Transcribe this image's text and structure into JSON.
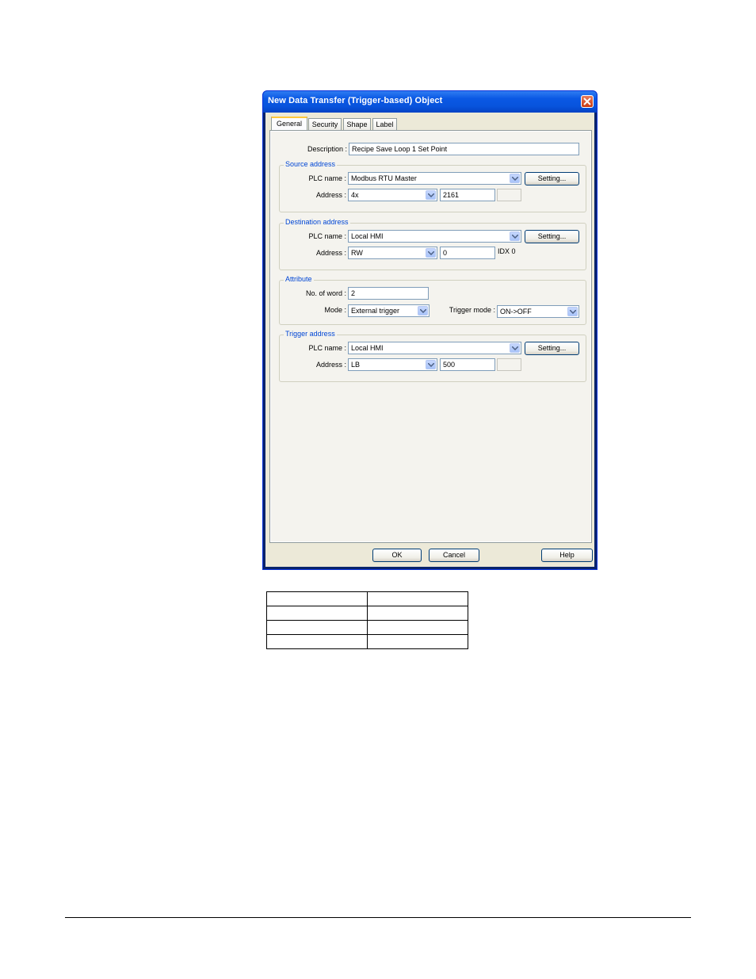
{
  "window": {
    "title": "New Data Transfer (Trigger-based) Object"
  },
  "tabs": [
    {
      "label": "General"
    },
    {
      "label": "Security"
    },
    {
      "label": "Shape"
    },
    {
      "label": "Label"
    }
  ],
  "description": {
    "label": "Description :",
    "value": "Recipe Save Loop 1 Set Point"
  },
  "source": {
    "title": "Source address",
    "plc_label": "PLC name :",
    "plc_value": "Modbus RTU Master",
    "setting_label": "Setting...",
    "address_label": "Address :",
    "address_type": "4x",
    "address_value": "2161"
  },
  "destination": {
    "title": "Destination address",
    "plc_label": "PLC name :",
    "plc_value": "Local HMI",
    "setting_label": "Setting...",
    "address_label": "Address :",
    "address_type": "RW",
    "address_value": "0",
    "idx_label": "IDX 0"
  },
  "attribute": {
    "title": "Attribute",
    "words_label": "No. of word :",
    "words_value": "2",
    "mode_label": "Mode :",
    "mode_value": "External trigger",
    "trigger_mode_label": "Trigger mode :",
    "trigger_mode_value": "ON->OFF"
  },
  "trigger": {
    "title": "Trigger address",
    "plc_label": "PLC name :",
    "plc_value": "Local HMI",
    "setting_label": "Setting...",
    "address_label": "Address :",
    "address_type": "LB",
    "address_value": "500"
  },
  "buttons": {
    "ok": "OK",
    "cancel": "Cancel",
    "help": "Help"
  }
}
